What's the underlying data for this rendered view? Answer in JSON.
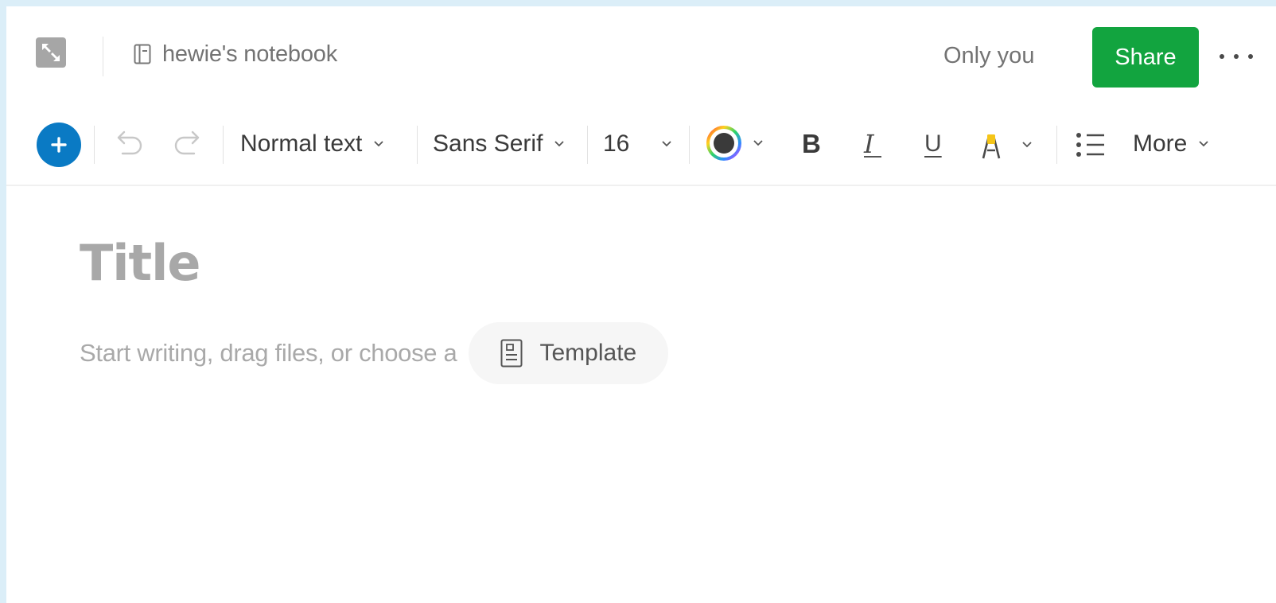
{
  "header": {
    "notebook_name": "hewie's notebook",
    "visibility": "Only you",
    "share_label": "Share"
  },
  "toolbar": {
    "text_style": "Normal text",
    "font_family": "Sans Serif",
    "font_size": "16",
    "bold_label": "B",
    "italic_label": "I",
    "underline_label": "U",
    "more_label": "More"
  },
  "editor": {
    "title_placeholder": "Title",
    "body_placeholder": "Start writing, drag files, or choose a",
    "template_label": "Template"
  },
  "colors": {
    "share_green": "#12a43f",
    "add_blue": "#0a7ac4",
    "highlight_yellow": "#f5c518"
  },
  "icons": [
    "expand-icon",
    "notebook-icon",
    "more-options-icon",
    "plus-icon",
    "undo-icon",
    "redo-icon",
    "chevron-down-icon",
    "text-color-icon",
    "highlighter-icon",
    "bulleted-list-icon",
    "template-icon"
  ]
}
